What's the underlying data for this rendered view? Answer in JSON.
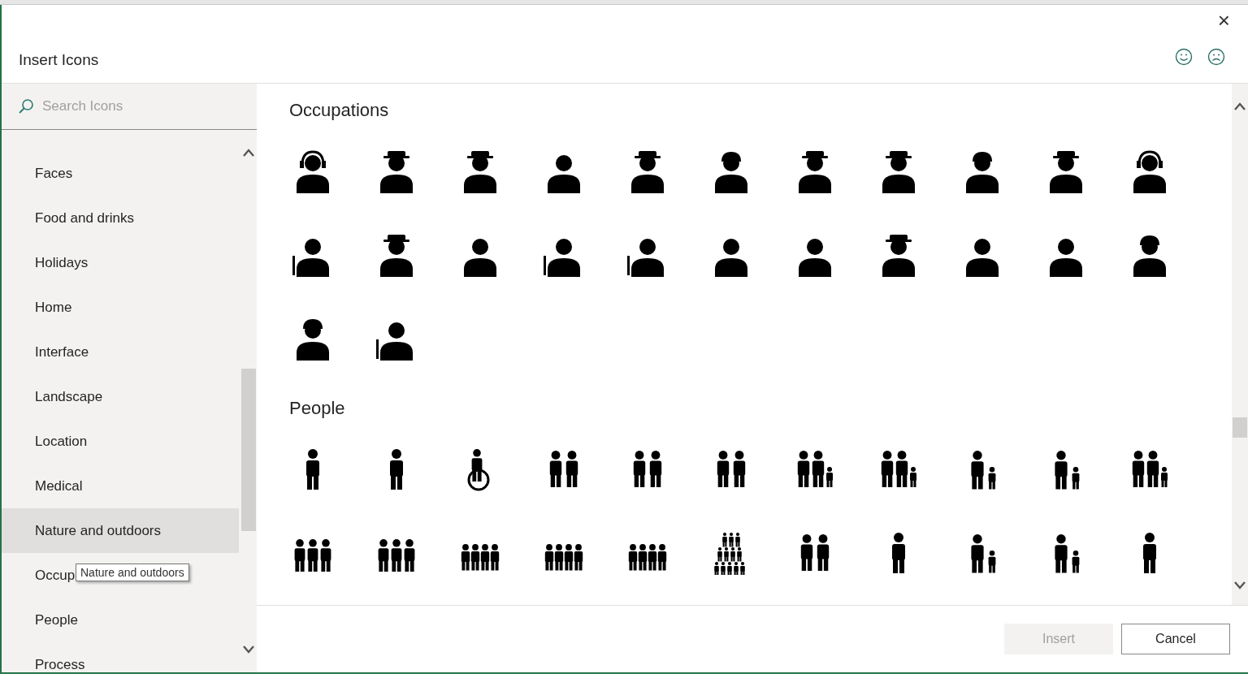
{
  "dialog": {
    "title": "Insert Icons",
    "close_label": "×"
  },
  "search": {
    "placeholder": "Search Icons"
  },
  "categories": [
    {
      "label": "Faces",
      "hovered": false
    },
    {
      "label": "Food and drinks",
      "hovered": false
    },
    {
      "label": "Holidays",
      "hovered": false
    },
    {
      "label": "Home",
      "hovered": false
    },
    {
      "label": "Interface",
      "hovered": false
    },
    {
      "label": "Landscape",
      "hovered": false
    },
    {
      "label": "Location",
      "hovered": false
    },
    {
      "label": "Medical",
      "hovered": false
    },
    {
      "label": "Nature and outdoors",
      "hovered": true
    },
    {
      "label": "Occup",
      "hovered": false
    },
    {
      "label": "People",
      "hovered": false
    },
    {
      "label": "Process",
      "hovered": false
    }
  ],
  "tooltip": {
    "text": "Nature and outdoors"
  },
  "sections": [
    {
      "title": "Occupations",
      "icons": [
        {
          "kind": "bust-headset"
        },
        {
          "kind": "bust-hat"
        },
        {
          "kind": "bust-hat"
        },
        {
          "kind": "bust"
        },
        {
          "kind": "bust-hat"
        },
        {
          "kind": "bust-helmet"
        },
        {
          "kind": "bust-hat"
        },
        {
          "kind": "bust-hat"
        },
        {
          "kind": "bust-helmet"
        },
        {
          "kind": "bust-hat"
        },
        {
          "kind": "bust-headset"
        },
        {
          "kind": "bust-tool"
        },
        {
          "kind": "bust-hat"
        },
        {
          "kind": "bust"
        },
        {
          "kind": "bust-tool"
        },
        {
          "kind": "bust-tool"
        },
        {
          "kind": "bust"
        },
        {
          "kind": "bust"
        },
        {
          "kind": "bust-hat"
        },
        {
          "kind": "bust"
        },
        {
          "kind": "bust"
        },
        {
          "kind": "bust-helmet"
        },
        {
          "kind": "bust-helmet"
        },
        {
          "kind": "bust-tool"
        }
      ]
    },
    {
      "title": "People",
      "icons": [
        {
          "kind": "figure"
        },
        {
          "kind": "figure"
        },
        {
          "kind": "wheelchair"
        },
        {
          "kind": "pair"
        },
        {
          "kind": "pair"
        },
        {
          "kind": "pair"
        },
        {
          "kind": "family"
        },
        {
          "kind": "family"
        },
        {
          "kind": "adult-child"
        },
        {
          "kind": "adult-child"
        },
        {
          "kind": "family"
        },
        {
          "kind": "group"
        },
        {
          "kind": "group"
        },
        {
          "kind": "group4"
        },
        {
          "kind": "group4"
        },
        {
          "kind": "group4"
        },
        {
          "kind": "crowd"
        },
        {
          "kind": "pair"
        },
        {
          "kind": "figure"
        },
        {
          "kind": "adult-child"
        },
        {
          "kind": "adult-child"
        },
        {
          "kind": "figure"
        }
      ]
    }
  ],
  "buttons": [
    {
      "label": "Insert",
      "disabled": true
    },
    {
      "label": "Cancel",
      "disabled": false
    }
  ]
}
